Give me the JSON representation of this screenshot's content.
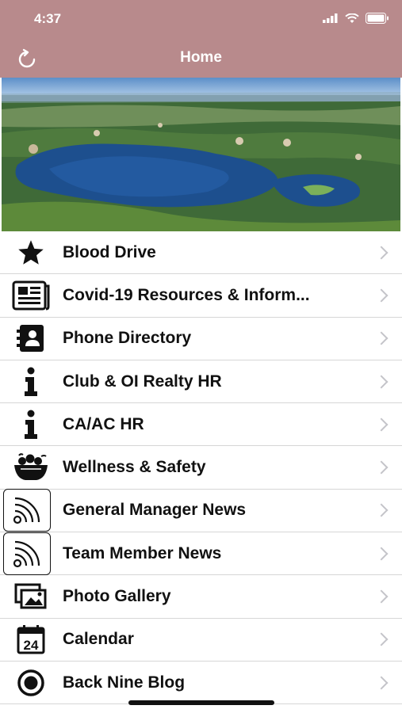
{
  "status": {
    "time": "4:37"
  },
  "header": {
    "title": "Home",
    "refresh_icon": "refresh-icon"
  },
  "hero": {
    "alt": "aerial-golf-course-lake-image"
  },
  "menu": [
    {
      "label": "Blood Drive",
      "icon": "star-icon"
    },
    {
      "label": "Covid-19 Resources & Inform...",
      "icon": "newspaper-icon"
    },
    {
      "label": "Phone Directory",
      "icon": "contact-book-icon"
    },
    {
      "label": "Club & OI Realty HR",
      "icon": "info-icon"
    },
    {
      "label": "CA/AC HR",
      "icon": "info-icon"
    },
    {
      "label": "Wellness & Safety",
      "icon": "fruit-basket-icon"
    },
    {
      "label": "General Manager News",
      "icon": "rss-icon"
    },
    {
      "label": "Team Member News",
      "icon": "rss-icon"
    },
    {
      "label": "Photo Gallery",
      "icon": "photo-gallery-icon"
    },
    {
      "label": "Calendar",
      "icon": "calendar-icon",
      "calendar_day": "24"
    },
    {
      "label": "Back Nine Blog",
      "icon": "record-icon"
    }
  ],
  "colors": {
    "header": "#b88a8c",
    "text": "#111111",
    "chevron": "#c4c4c9"
  }
}
